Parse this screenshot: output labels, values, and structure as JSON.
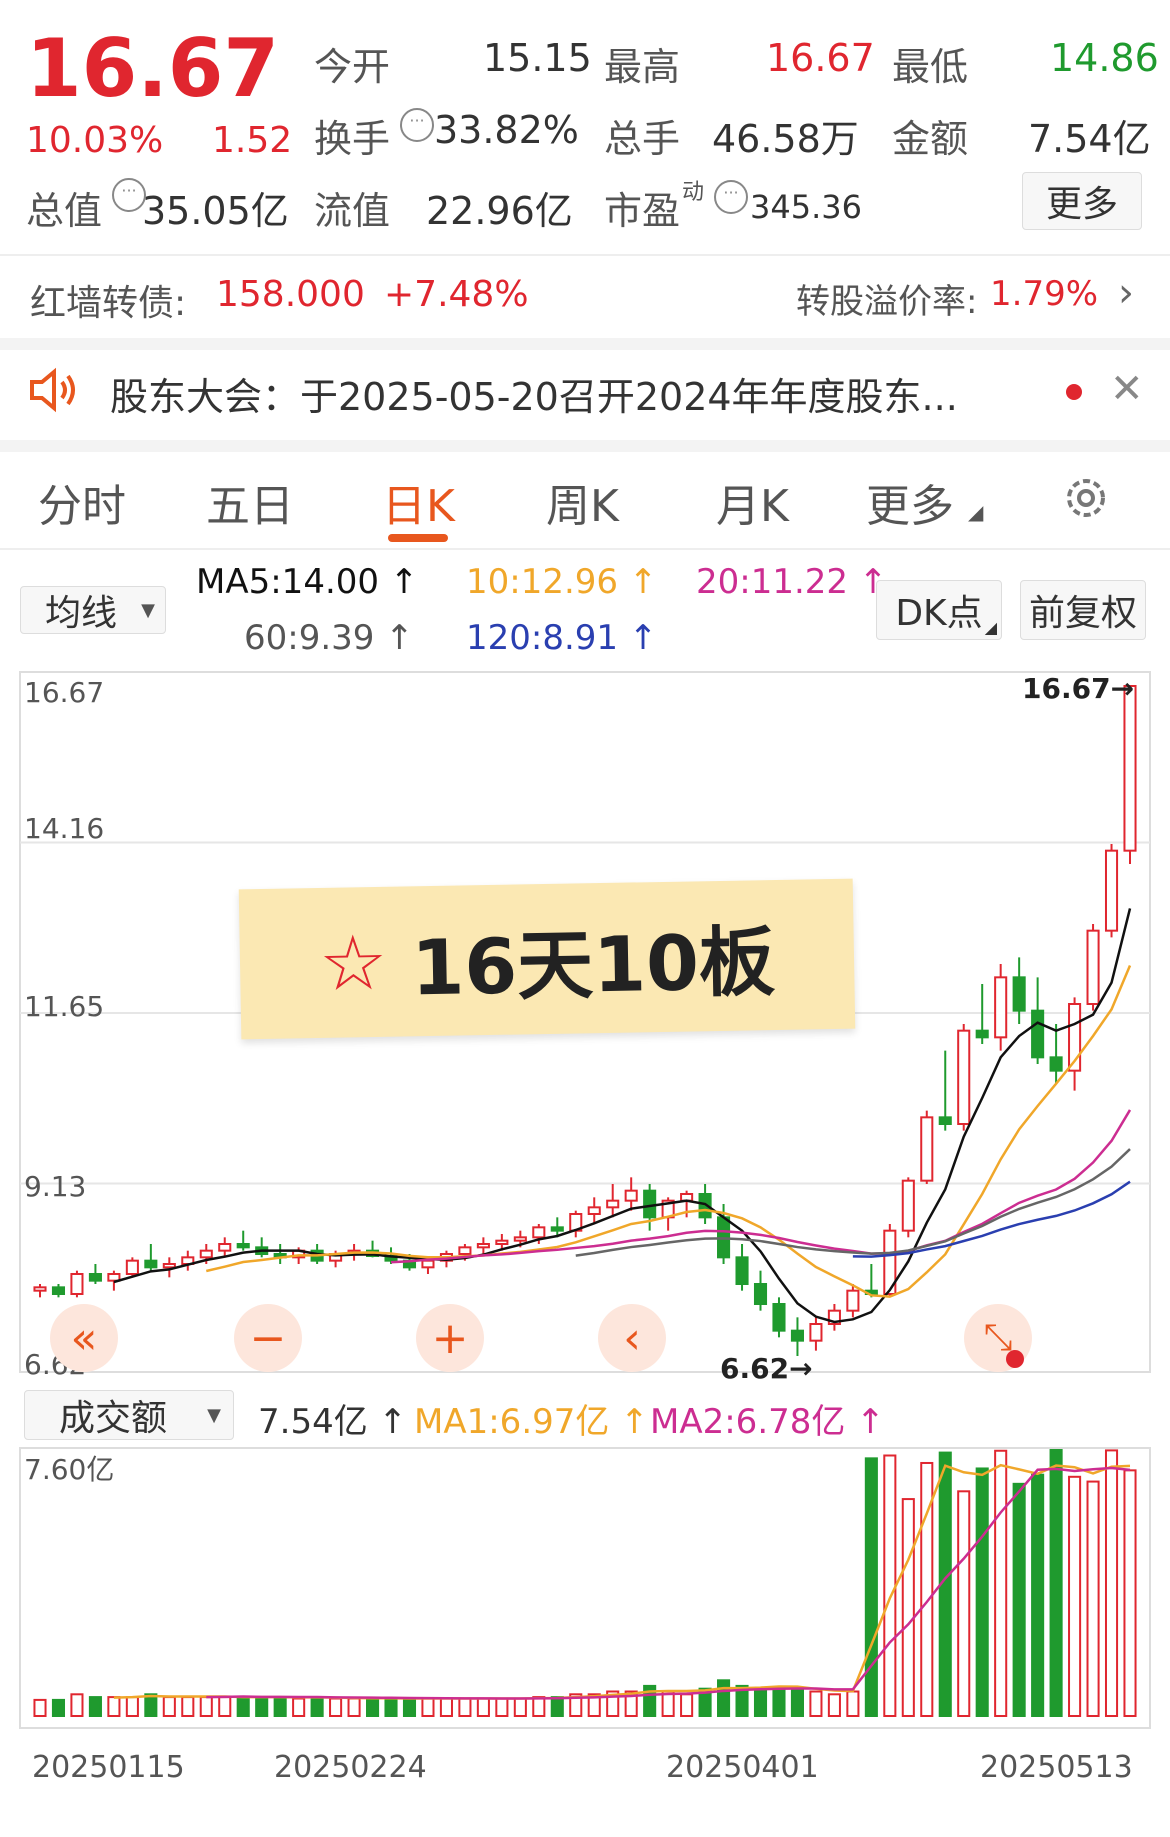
{
  "quote": {
    "price": "16.67",
    "change_pct": "10.03%",
    "change_amt": "1.52",
    "open_label": "今开",
    "open_value": "15.15",
    "high_label": "最高",
    "high_value": "16.67",
    "low_label": "最低",
    "low_value": "14.86",
    "turnover_label": "换手",
    "turnover_value": "33.82%",
    "volume_label": "总手",
    "volume_value": "46.58万",
    "amount_label": "金额",
    "amount_value": "7.54亿",
    "mktcap_label": "总值",
    "mktcap_value": "35.05亿",
    "float_label": "流值",
    "float_value": "22.96亿",
    "pe_label": "市盈",
    "pe_sup": "动",
    "pe_value": "345.36",
    "more_button": "更多"
  },
  "bond": {
    "label": "红墙转债:",
    "price": "158.000",
    "change": "+7.48%",
    "premium_label": "转股溢价率:",
    "premium_value": "1.79%"
  },
  "notice": {
    "text": "股东大会：于2025-05-20召开2024年年度股东..."
  },
  "tabs": [
    "分时",
    "五日",
    "日K",
    "周K",
    "月K",
    "更多"
  ],
  "active_tab": "日K",
  "kline": {
    "ma_selector": "均线",
    "ma5": "MA5:14.00",
    "ma10": "10:12.96",
    "ma20": "20:11.22",
    "ma60": "60:9.39",
    "ma120": "120:8.91",
    "dk_button": "DK点",
    "adjust_button": "前复权",
    "y_labels": [
      "16.67",
      "14.16",
      "11.65",
      "9.13",
      "6.62"
    ],
    "max_marker": "16.67",
    "min_marker": "6.62",
    "banner": "16天10板"
  },
  "volume": {
    "selector": "成交额",
    "amount": "7.54亿",
    "ma1": "MA1:6.97亿",
    "ma2": "MA2:6.78亿",
    "ymax": "7.60亿"
  },
  "x_dates": [
    "20250115",
    "20250224",
    "20250401",
    "20250513"
  ],
  "colors": {
    "up": "#e0262f",
    "down": "#1f9a2e",
    "accent": "#e8571e",
    "ma5": "#111111",
    "ma10": "#f0a72a",
    "ma20": "#cc2d91",
    "ma60": "#666666",
    "ma120": "#2a3fb0"
  },
  "chart_data": {
    "type": "candlestick",
    "ylim": [
      6.62,
      16.67
    ],
    "candles": [
      [
        7.6,
        7.7,
        7.5,
        7.65
      ],
      [
        7.65,
        7.7,
        7.5,
        7.55
      ],
      [
        7.55,
        7.9,
        7.5,
        7.85
      ],
      [
        7.85,
        8.0,
        7.7,
        7.75
      ],
      [
        7.75,
        7.9,
        7.6,
        7.85
      ],
      [
        7.85,
        8.1,
        7.8,
        8.05
      ],
      [
        8.05,
        8.3,
        7.9,
        7.95
      ],
      [
        7.95,
        8.1,
        7.8,
        8.0
      ],
      [
        8.0,
        8.2,
        7.9,
        8.1
      ],
      [
        8.1,
        8.3,
        8.0,
        8.2
      ],
      [
        8.2,
        8.4,
        8.1,
        8.3
      ],
      [
        8.3,
        8.5,
        8.2,
        8.25
      ],
      [
        8.25,
        8.4,
        8.1,
        8.15
      ],
      [
        8.15,
        8.3,
        8.0,
        8.1
      ],
      [
        8.1,
        8.25,
        8.0,
        8.2
      ],
      [
        8.2,
        8.3,
        8.0,
        8.05
      ],
      [
        8.05,
        8.2,
        7.95,
        8.15
      ],
      [
        8.15,
        8.3,
        8.05,
        8.2
      ],
      [
        8.2,
        8.35,
        8.1,
        8.12
      ],
      [
        8.12,
        8.25,
        8.0,
        8.05
      ],
      [
        8.05,
        8.15,
        7.9,
        7.95
      ],
      [
        7.95,
        8.1,
        7.85,
        8.05
      ],
      [
        8.05,
        8.2,
        7.95,
        8.15
      ],
      [
        8.15,
        8.3,
        8.05,
        8.25
      ],
      [
        8.25,
        8.4,
        8.15,
        8.3
      ],
      [
        8.3,
        8.45,
        8.2,
        8.35
      ],
      [
        8.35,
        8.5,
        8.25,
        8.4
      ],
      [
        8.4,
        8.6,
        8.3,
        8.55
      ],
      [
        8.55,
        8.7,
        8.4,
        8.5
      ],
      [
        8.5,
        8.8,
        8.4,
        8.75
      ],
      [
        8.75,
        9.0,
        8.6,
        8.85
      ],
      [
        8.85,
        9.2,
        8.7,
        8.95
      ],
      [
        8.95,
        9.3,
        8.8,
        9.1
      ],
      [
        9.1,
        9.2,
        8.5,
        8.7
      ],
      [
        8.7,
        9.0,
        8.5,
        8.95
      ],
      [
        8.95,
        9.1,
        8.7,
        9.05
      ],
      [
        9.05,
        9.2,
        8.6,
        8.7
      ],
      [
        8.7,
        8.9,
        8.0,
        8.1
      ],
      [
        8.1,
        8.3,
        7.6,
        7.7
      ],
      [
        7.7,
        7.9,
        7.3,
        7.4
      ],
      [
        7.4,
        7.5,
        6.9,
        7.0
      ],
      [
        7.0,
        7.2,
        6.62,
        6.85
      ],
      [
        6.85,
        7.2,
        6.7,
        7.1
      ],
      [
        7.1,
        7.4,
        7.0,
        7.3
      ],
      [
        7.3,
        7.7,
        7.2,
        7.6
      ],
      [
        7.6,
        8.0,
        7.5,
        7.55
      ],
      [
        7.55,
        8.6,
        7.5,
        8.5
      ],
      [
        8.5,
        9.3,
        8.4,
        9.25
      ],
      [
        9.25,
        10.3,
        9.2,
        10.2
      ],
      [
        10.2,
        11.2,
        10.0,
        10.1
      ],
      [
        10.1,
        11.6,
        10.0,
        11.5
      ],
      [
        11.5,
        12.2,
        11.3,
        11.4
      ],
      [
        11.4,
        12.5,
        11.2,
        12.3
      ],
      [
        12.3,
        12.6,
        11.6,
        11.8
      ],
      [
        11.8,
        12.3,
        11.0,
        11.1
      ],
      [
        11.1,
        11.6,
        10.7,
        10.9
      ],
      [
        10.9,
        12.0,
        10.6,
        11.9
      ],
      [
        11.9,
        13.1,
        11.8,
        13.0
      ],
      [
        13.0,
        14.3,
        12.9,
        14.2
      ],
      [
        14.2,
        16.67,
        14.0,
        16.67
      ]
    ]
  }
}
